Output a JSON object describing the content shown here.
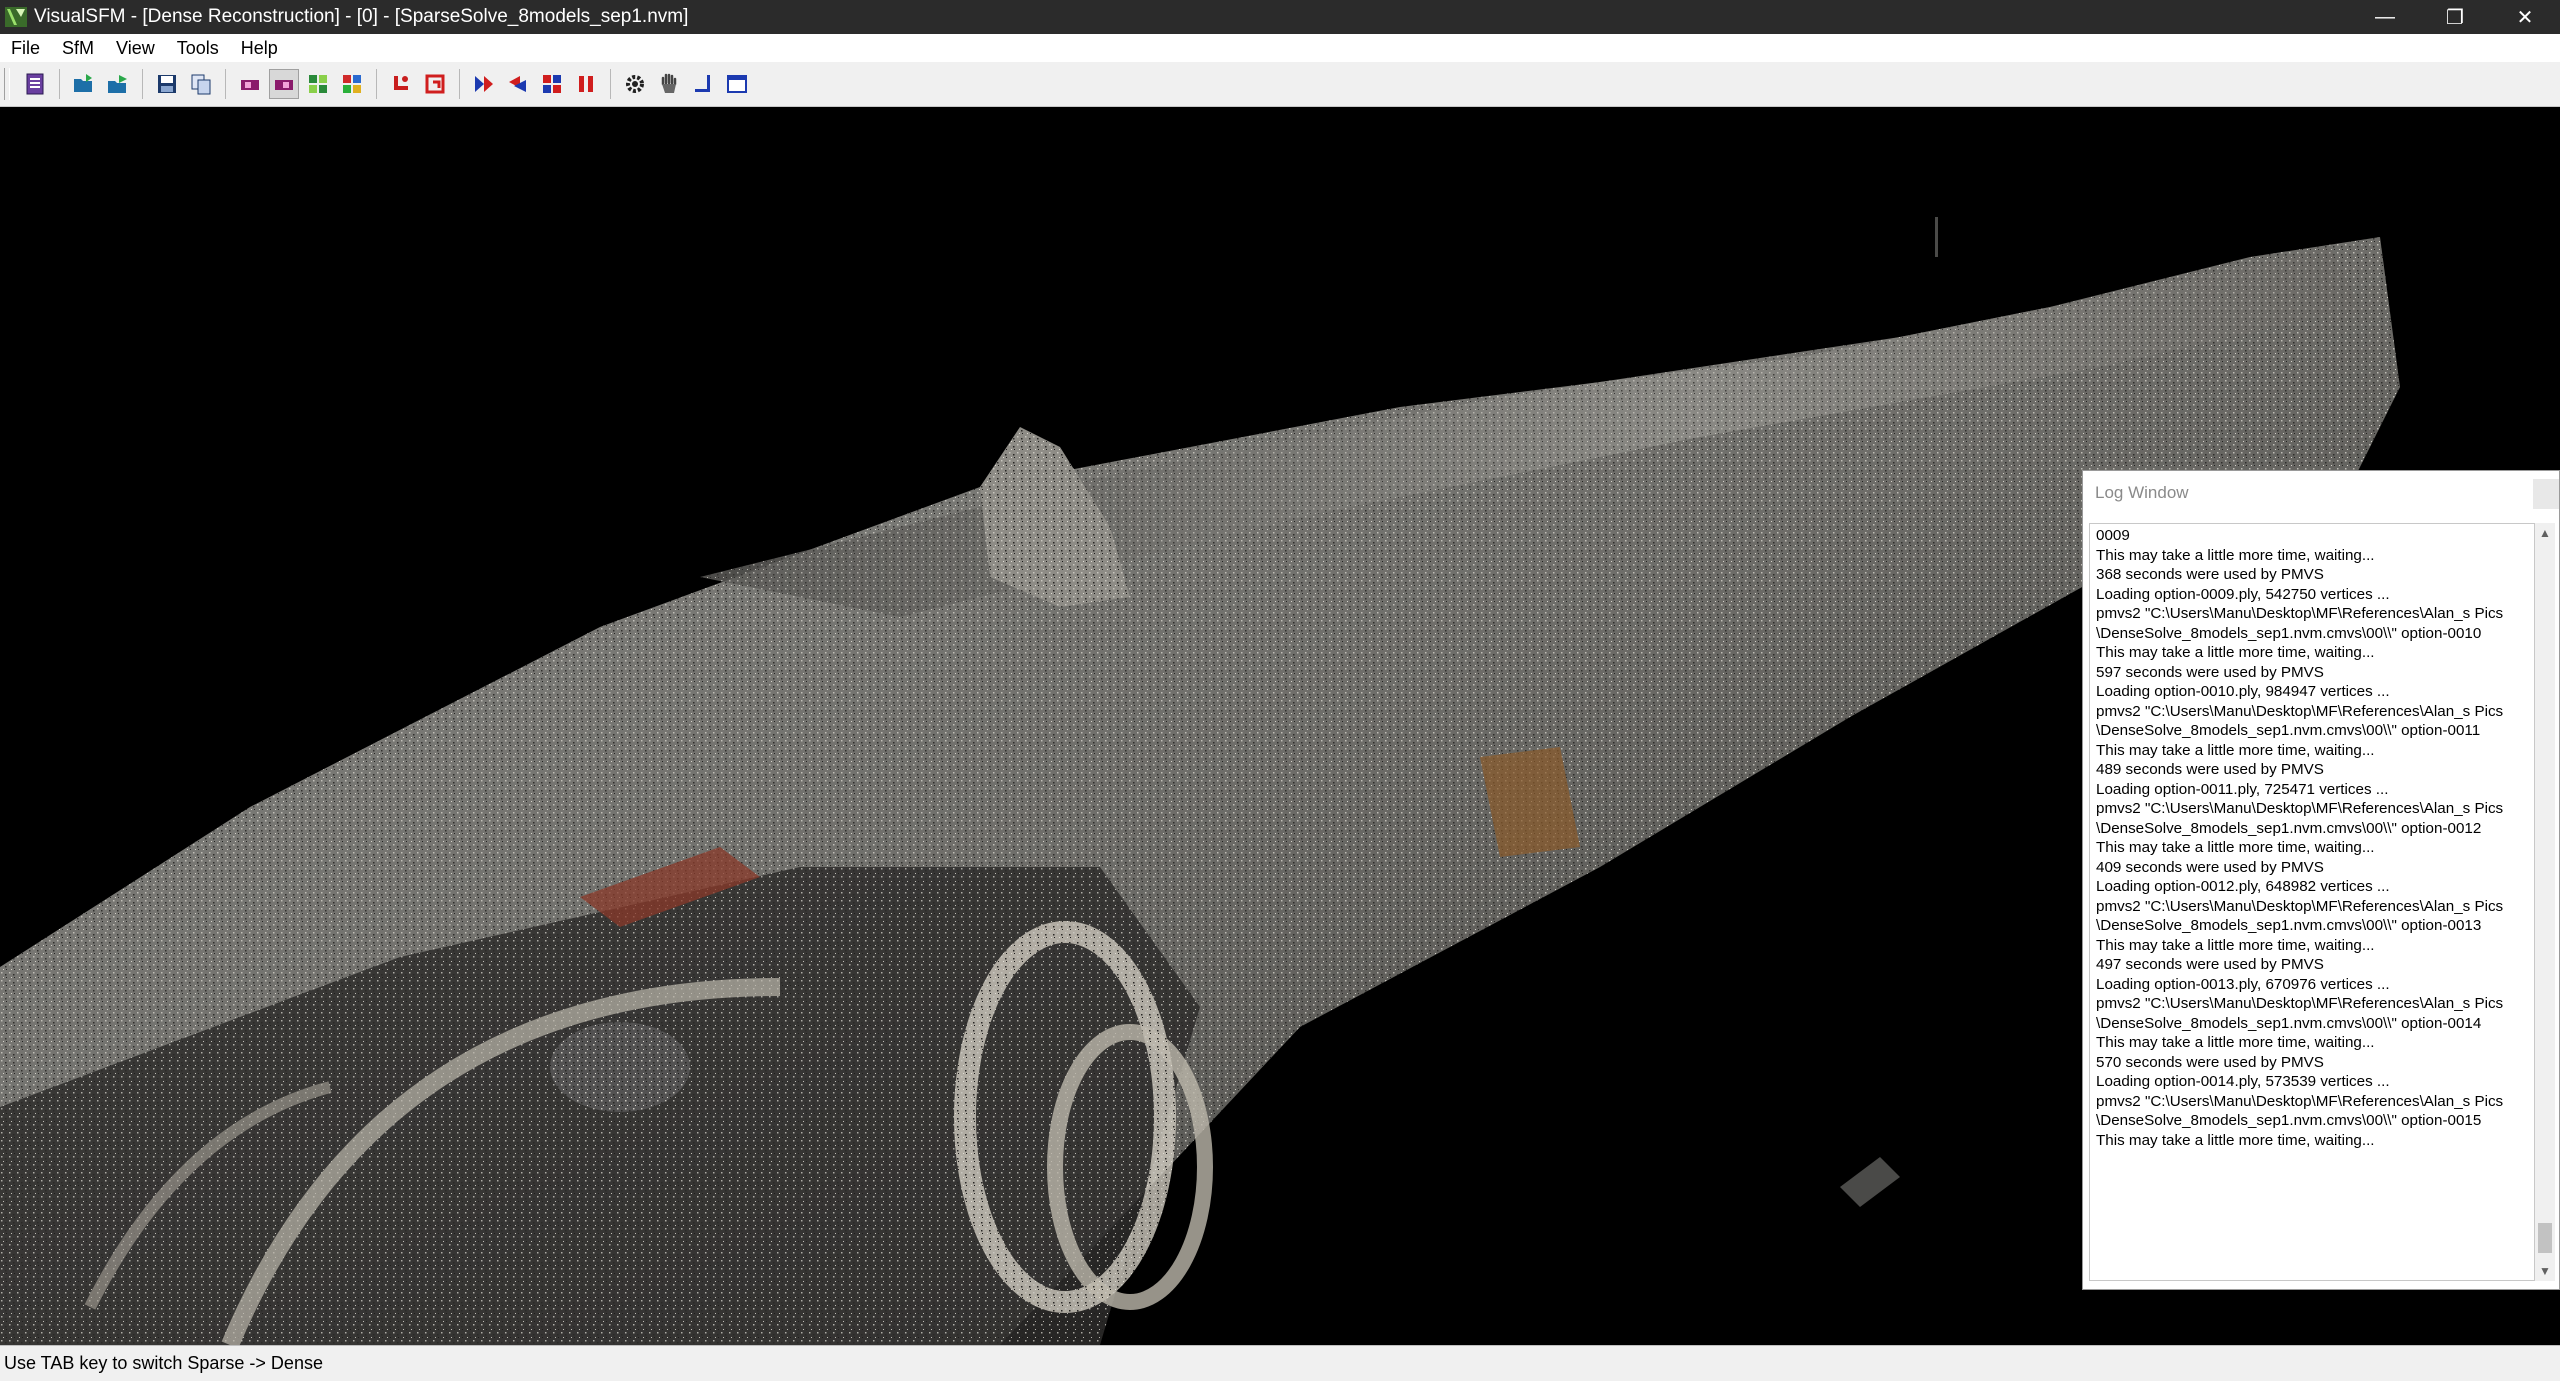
{
  "window": {
    "title": "VisualSFM - [Dense Reconstruction] - [0] - [SparseSolve_8models_sep1.nvm]",
    "minimize": "—",
    "maximize": "❐",
    "close": "✕"
  },
  "menu": {
    "items": [
      "File",
      "SfM",
      "View",
      "Tools",
      "Help"
    ]
  },
  "toolbar": {
    "buttons": [
      "log-icon",
      "open-icon",
      "open-multiple-icon",
      "save-icon",
      "copy-icon",
      "match-icon",
      "match-pressed-icon",
      "pairwise-icon",
      "grid-icon",
      "reconstruct-icon",
      "reset-icon",
      "run-icon",
      "run-all-icon",
      "cmvs-icon",
      "pause-icon",
      "gear-icon",
      "hand-icon",
      "resize-icon",
      "window-icon"
    ]
  },
  "viewport": {
    "description_mode": "dense"
  },
  "log_window": {
    "title": "Log Window",
    "lines": [
      "0009",
      "This may take a little more time, waiting...",
      "368 seconds were used by PMVS",
      "Loading option-0009.ply, 542750 vertices ...",
      "pmvs2 \"C:\\Users\\Manu\\Desktop\\MF\\References\\Alan_s Pics\\DenseSolve_8models_sep1.nvm.cmvs\\00\\\\\" option-0010",
      "This may take a little more time, waiting...",
      "597 seconds were used by PMVS",
      "Loading option-0010.ply, 984947 vertices ...",
      "pmvs2 \"C:\\Users\\Manu\\Desktop\\MF\\References\\Alan_s Pics\\DenseSolve_8models_sep1.nvm.cmvs\\00\\\\\" option-0011",
      "This may take a little more time, waiting...",
      "489 seconds were used by PMVS",
      "Loading option-0011.ply, 725471 vertices ...",
      "pmvs2 \"C:\\Users\\Manu\\Desktop\\MF\\References\\Alan_s Pics\\DenseSolve_8models_sep1.nvm.cmvs\\00\\\\\" option-0012",
      "This may take a little more time, waiting...",
      "409 seconds were used by PMVS",
      "Loading option-0012.ply, 648982 vertices ...",
      "pmvs2 \"C:\\Users\\Manu\\Desktop\\MF\\References\\Alan_s Pics\\DenseSolve_8models_sep1.nvm.cmvs\\00\\\\\" option-0013",
      "This may take a little more time, waiting...",
      "497 seconds were used by PMVS",
      "Loading option-0013.ply, 670976 vertices ...",
      "pmvs2 \"C:\\Users\\Manu\\Desktop\\MF\\References\\Alan_s Pics\\DenseSolve_8models_sep1.nvm.cmvs\\00\\\\\" option-0014",
      "This may take a little more time, waiting...",
      "570 seconds were used by PMVS",
      "Loading option-0014.ply, 573539 vertices ...",
      "pmvs2 \"C:\\Users\\Manu\\Desktop\\MF\\References\\Alan_s Pics\\DenseSolve_8models_sep1.nvm.cmvs\\00\\\\\" option-0015",
      "This may take a little more time, waiting..."
    ]
  },
  "status": {
    "text": "Use TAB key to switch Sparse -> Dense"
  }
}
